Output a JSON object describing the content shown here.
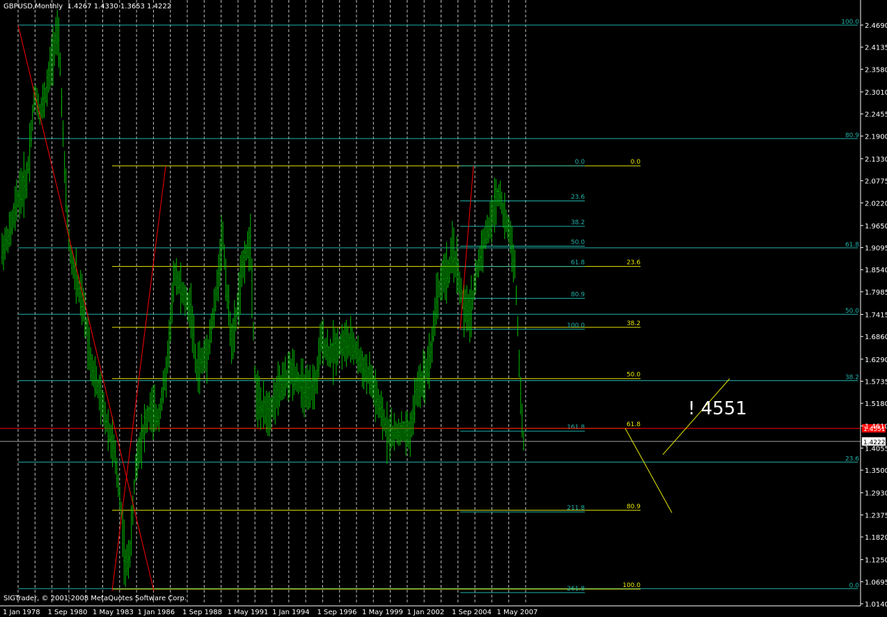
{
  "header": {
    "symbol": "GBPUSD,Monthly",
    "ohlc": "1.4267 1.4330 1.3653 1.4222"
  },
  "footer": {
    "copyright": "SIGTrader, © 2001-2008 MetaQuotes Software Corp."
  },
  "annotation": {
    "text": "! 4551"
  },
  "colors": {
    "background": "#000000",
    "candles": "#00c000",
    "grid": "#ffffff",
    "fib_cyan": "#20b2aa",
    "fib_yellow": "#e8e800",
    "trend_red": "#ff0000",
    "price_line": "#ff0000",
    "axis_text": "#ffffff"
  },
  "chart_data": {
    "type": "candlestick",
    "symbol": "GBPUSD",
    "timeframe": "Monthly",
    "ylim": [
      1.014,
      2.469
    ],
    "y_ticks": [
      "2.4690",
      "2.4135",
      "2.3580",
      "2.3010",
      "2.2455",
      "2.1900",
      "2.1330",
      "2.0775",
      "2.0220",
      "1.9650",
      "1.9095",
      "1.8540",
      "1.7985",
      "1.7415",
      "1.6860",
      "1.6290",
      "1.5735",
      "1.5180",
      "1.4610",
      "1.4055",
      "1.3500",
      "1.2930",
      "1.2375",
      "1.1820",
      "1.1250",
      "1.0695",
      "1.0140"
    ],
    "x_ticks": [
      "1 Jan 1978",
      "1 Sep 1980",
      "1 May 1983",
      "1 Jan 1986",
      "1 Sep 1988",
      "1 May 1991",
      "1 Jan 1994",
      "1 Sep 1996",
      "1 May 1999",
      "1 Jan 2002",
      "1 Sep 2004",
      "1 May 2007"
    ],
    "x_range": [
      1977.4,
      2008.3
    ],
    "current_price": "1.4222",
    "marked_price": "1.4551",
    "price_series": [
      [
        1977.5,
        1.9
      ],
      [
        1978.0,
        1.95
      ],
      [
        1978.5,
        2.04
      ],
      [
        1979.0,
        2.08
      ],
      [
        1979.5,
        2.3
      ],
      [
        1979.8,
        2.25
      ],
      [
        1980.2,
        2.3
      ],
      [
        1980.5,
        2.38
      ],
      [
        1980.8,
        2.45
      ],
      [
        1981.0,
        2.4
      ],
      [
        1981.3,
        2.1
      ],
      [
        1981.6,
        1.9
      ],
      [
        1982.0,
        1.83
      ],
      [
        1982.5,
        1.75
      ],
      [
        1982.9,
        1.62
      ],
      [
        1983.3,
        1.56
      ],
      [
        1983.8,
        1.48
      ],
      [
        1984.3,
        1.4
      ],
      [
        1984.7,
        1.27
      ],
      [
        1985.0,
        1.1
      ],
      [
        1985.3,
        1.15
      ],
      [
        1985.6,
        1.35
      ],
      [
        1986.0,
        1.44
      ],
      [
        1986.5,
        1.5
      ],
      [
        1987.0,
        1.48
      ],
      [
        1987.5,
        1.6
      ],
      [
        1987.8,
        1.75
      ],
      [
        1988.0,
        1.85
      ],
      [
        1988.5,
        1.79
      ],
      [
        1989.0,
        1.75
      ],
      [
        1989.3,
        1.6
      ],
      [
        1989.6,
        1.62
      ],
      [
        1990.0,
        1.65
      ],
      [
        1990.5,
        1.78
      ],
      [
        1990.9,
        1.95
      ],
      [
        1991.2,
        1.78
      ],
      [
        1991.5,
        1.66
      ],
      [
        1991.8,
        1.76
      ],
      [
        1992.2,
        1.88
      ],
      [
        1992.6,
        1.93
      ],
      [
        1992.9,
        1.55
      ],
      [
        1993.3,
        1.5
      ],
      [
        1993.8,
        1.5
      ],
      [
        1994.3,
        1.55
      ],
      [
        1994.8,
        1.58
      ],
      [
        1995.2,
        1.6
      ],
      [
        1995.7,
        1.56
      ],
      [
        1996.1,
        1.54
      ],
      [
        1996.6,
        1.57
      ],
      [
        1996.9,
        1.68
      ],
      [
        1997.4,
        1.64
      ],
      [
        1997.9,
        1.66
      ],
      [
        1998.4,
        1.67
      ],
      [
        1998.9,
        1.66
      ],
      [
        1999.4,
        1.61
      ],
      [
        1999.9,
        1.58
      ],
      [
        2000.4,
        1.51
      ],
      [
        2000.9,
        1.45
      ],
      [
        2001.3,
        1.44
      ],
      [
        2001.8,
        1.45
      ],
      [
        2002.3,
        1.44
      ],
      [
        2002.7,
        1.55
      ],
      [
        2003.1,
        1.58
      ],
      [
        2003.6,
        1.65
      ],
      [
        2003.9,
        1.78
      ],
      [
        2004.3,
        1.84
      ],
      [
        2004.7,
        1.85
      ],
      [
        2004.9,
        1.91
      ],
      [
        2005.3,
        1.82
      ],
      [
        2005.6,
        1.75
      ],
      [
        2006.0,
        1.75
      ],
      [
        2006.3,
        1.84
      ],
      [
        2006.8,
        1.93
      ],
      [
        2007.2,
        1.97
      ],
      [
        2007.5,
        2.03
      ],
      [
        2007.8,
        2.05
      ],
      [
        2008.0,
        1.98
      ],
      [
        2008.3,
        1.96
      ],
      [
        2008.7,
        1.85
      ],
      [
        2009.0,
        1.55
      ],
      [
        2009.2,
        1.42
      ]
    ],
    "fib_levels_left": [
      {
        "label": "100.0",
        "price": 2.469,
        "color": "cyan"
      },
      {
        "label": "80.9",
        "price": 2.1835,
        "color": "cyan"
      },
      {
        "label": "61.8",
        "price": 1.909,
        "color": "cyan"
      },
      {
        "label": "50.0",
        "price": 1.742,
        "color": "cyan"
      },
      {
        "label": "38.2",
        "price": 1.575,
        "color": "cyan"
      },
      {
        "label": "23.6",
        "price": 1.37,
        "color": "cyan"
      },
      {
        "label": "0.0",
        "price": 1.052,
        "color": "cyan"
      }
    ],
    "fib_levels_mid_yellow": [
      {
        "label": "0.0",
        "price": 2.115
      },
      {
        "label": "23.6",
        "price": 1.862
      },
      {
        "label": "38.2",
        "price": 1.709
      },
      {
        "label": "50.0",
        "price": 1.58
      },
      {
        "label": "61.8",
        "price": 1.455
      },
      {
        "label": "80.9",
        "price": 1.249
      },
      {
        "label": "100.0",
        "price": 1.051
      }
    ],
    "fib_levels_right_cyan": [
      {
        "label": "0.0",
        "price": 2.115
      },
      {
        "label": "23.6",
        "price": 2.027
      },
      {
        "label": "38.2",
        "price": 1.963
      },
      {
        "label": "50.0",
        "price": 1.913
      },
      {
        "label": "61.8",
        "price": 1.862
      },
      {
        "label": "80.9",
        "price": 1.782
      },
      {
        "label": "100.0",
        "price": 1.704
      },
      {
        "label": "161.8",
        "price": 1.448
      },
      {
        "label": "211.8",
        "price": 1.245
      },
      {
        "label": "261.8",
        "price": 1.042
      }
    ],
    "price_line_label": "1.4551"
  }
}
